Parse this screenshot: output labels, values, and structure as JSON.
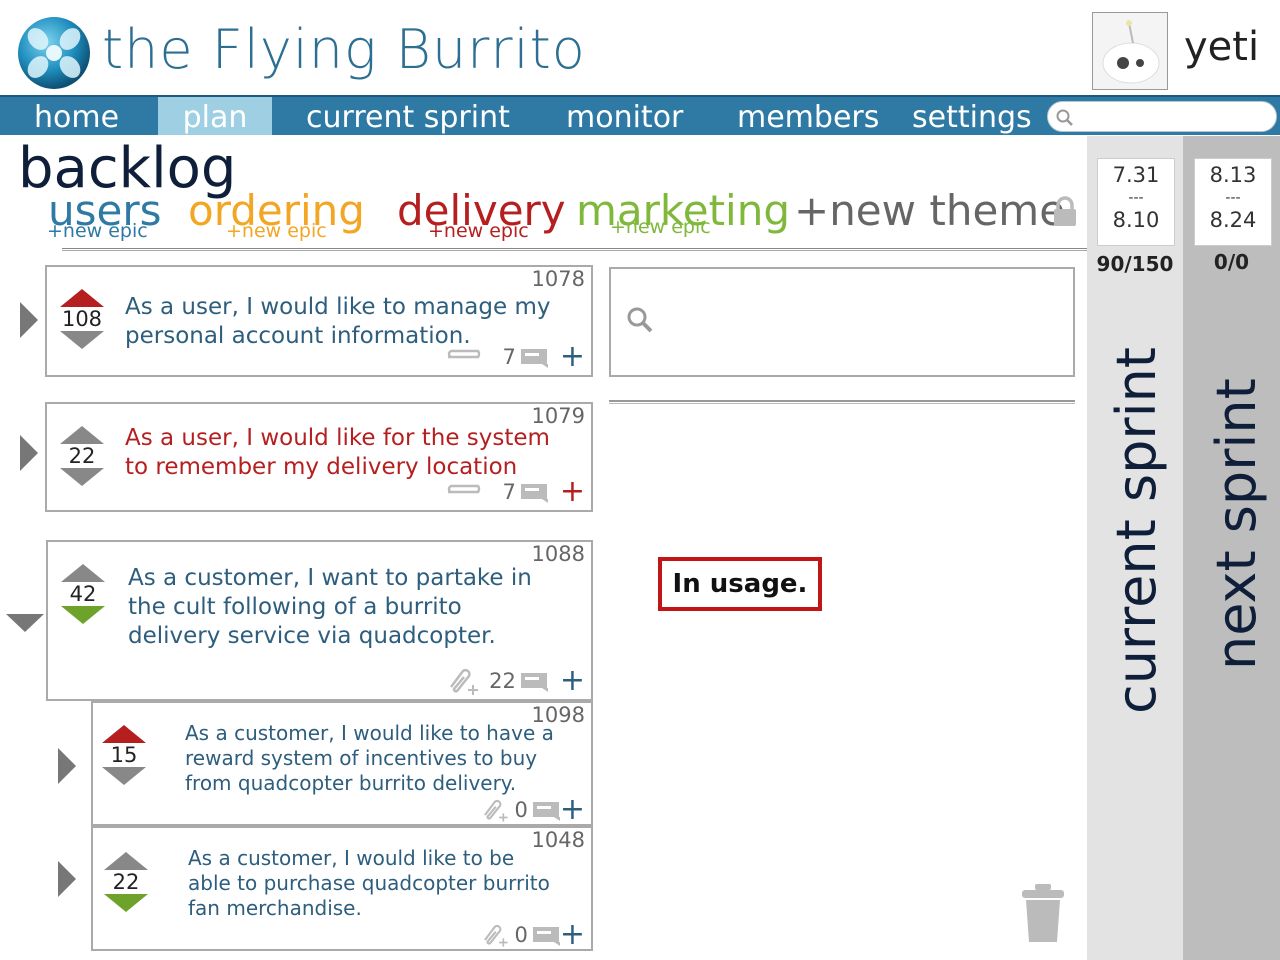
{
  "header": {
    "app_title": "the Flying Burrito",
    "username": "yeti",
    "logo_icon": "flying-burrito-logo",
    "avatar_icon": "cartoon-avatar"
  },
  "nav": {
    "items": [
      {
        "label": "home",
        "active": false
      },
      {
        "label": "plan",
        "active": true
      },
      {
        "label": "current sprint",
        "active": false
      },
      {
        "label": "monitor",
        "active": false
      },
      {
        "label": "members",
        "active": false
      },
      {
        "label": "settings",
        "active": false
      }
    ],
    "search_placeholder": ""
  },
  "backlog": {
    "title": "backlog",
    "themes": [
      {
        "label": "users",
        "color": "#2e7aa4",
        "new_epic": "+new epic"
      },
      {
        "label": "ordering",
        "color": "#f2a624",
        "new_epic": "+new epic"
      },
      {
        "label": "delivery",
        "color": "#b51f1f",
        "new_epic": "+new epic"
      },
      {
        "label": "marketing",
        "color": "#7fb83a",
        "new_epic": "+new epic"
      }
    ],
    "new_theme_label": "+new theme"
  },
  "stories": [
    {
      "id": "1078",
      "votes": "108",
      "text_lines": [
        "As a user, I would like to manage my",
        "personal account information."
      ],
      "comments": "7",
      "color": "#2e5e7e",
      "vote_state": "up"
    },
    {
      "id": "1079",
      "votes": "22",
      "text_lines": [
        "As a user, I would like for the system",
        "to remember my delivery location"
      ],
      "comments": "7",
      "color": "#b51f1f",
      "vote_state": "none"
    },
    {
      "id": "1088",
      "votes": "42",
      "text_lines": [
        "As a customer, I want to partake in",
        "the cult following of  a burrito",
        "delivery service via quadcopter."
      ],
      "comments": "22",
      "color": "#2e5e7e",
      "vote_state": "down",
      "expanded": true
    },
    {
      "id": "1098",
      "votes": "15",
      "text_lines": [
        "As a customer, I would like to have a",
        "reward system of  incentives to buy",
        "from quadcopter burrito delivery."
      ],
      "comments": "0",
      "color": "#2e5e7e",
      "vote_state": "up"
    },
    {
      "id": "1048",
      "votes": "22",
      "text_lines": [
        "As a customer, I would like to be",
        "able to purchase quadcopter burrito",
        "fan merchandise."
      ],
      "comments": "0",
      "color": "#2e5e7e",
      "vote_state": "down"
    }
  ],
  "panel": {
    "notice": "In usage."
  },
  "sprints": {
    "current": {
      "label": "current sprint",
      "start": "7.31",
      "sep": "---",
      "end": "8.10",
      "points": "90/150"
    },
    "next": {
      "label": "next sprint",
      "start": "8.13",
      "sep": "---",
      "end": "8.24",
      "points": "0/0"
    }
  }
}
